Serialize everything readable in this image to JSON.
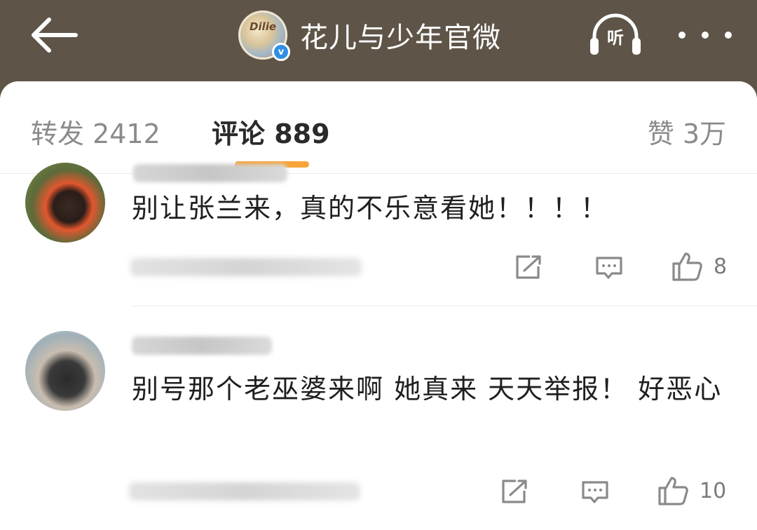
{
  "header": {
    "account_name": "花儿与少年官微",
    "avatar_text": "Dilie",
    "verified_mark": "v",
    "listen_label": "听"
  },
  "tabs": {
    "repost": "转发 2412",
    "comments": "评论 889",
    "likes": "赞 3万"
  },
  "comments": [
    {
      "text": "别让张兰来，真的不乐意看她！！！！",
      "likes": "8"
    },
    {
      "text": "别号那个老巫婆来啊 她真来 天天举报！ 好恶心",
      "likes": "10"
    }
  ],
  "colors": {
    "topbar": "#5e5548",
    "accent_underline": "#f7a43a",
    "verified": "#2f8fe3"
  },
  "icons": [
    "back-arrow-icon",
    "verified-icon",
    "headphones-icon",
    "more-icon",
    "share-icon",
    "comment-icon",
    "like-icon"
  ]
}
